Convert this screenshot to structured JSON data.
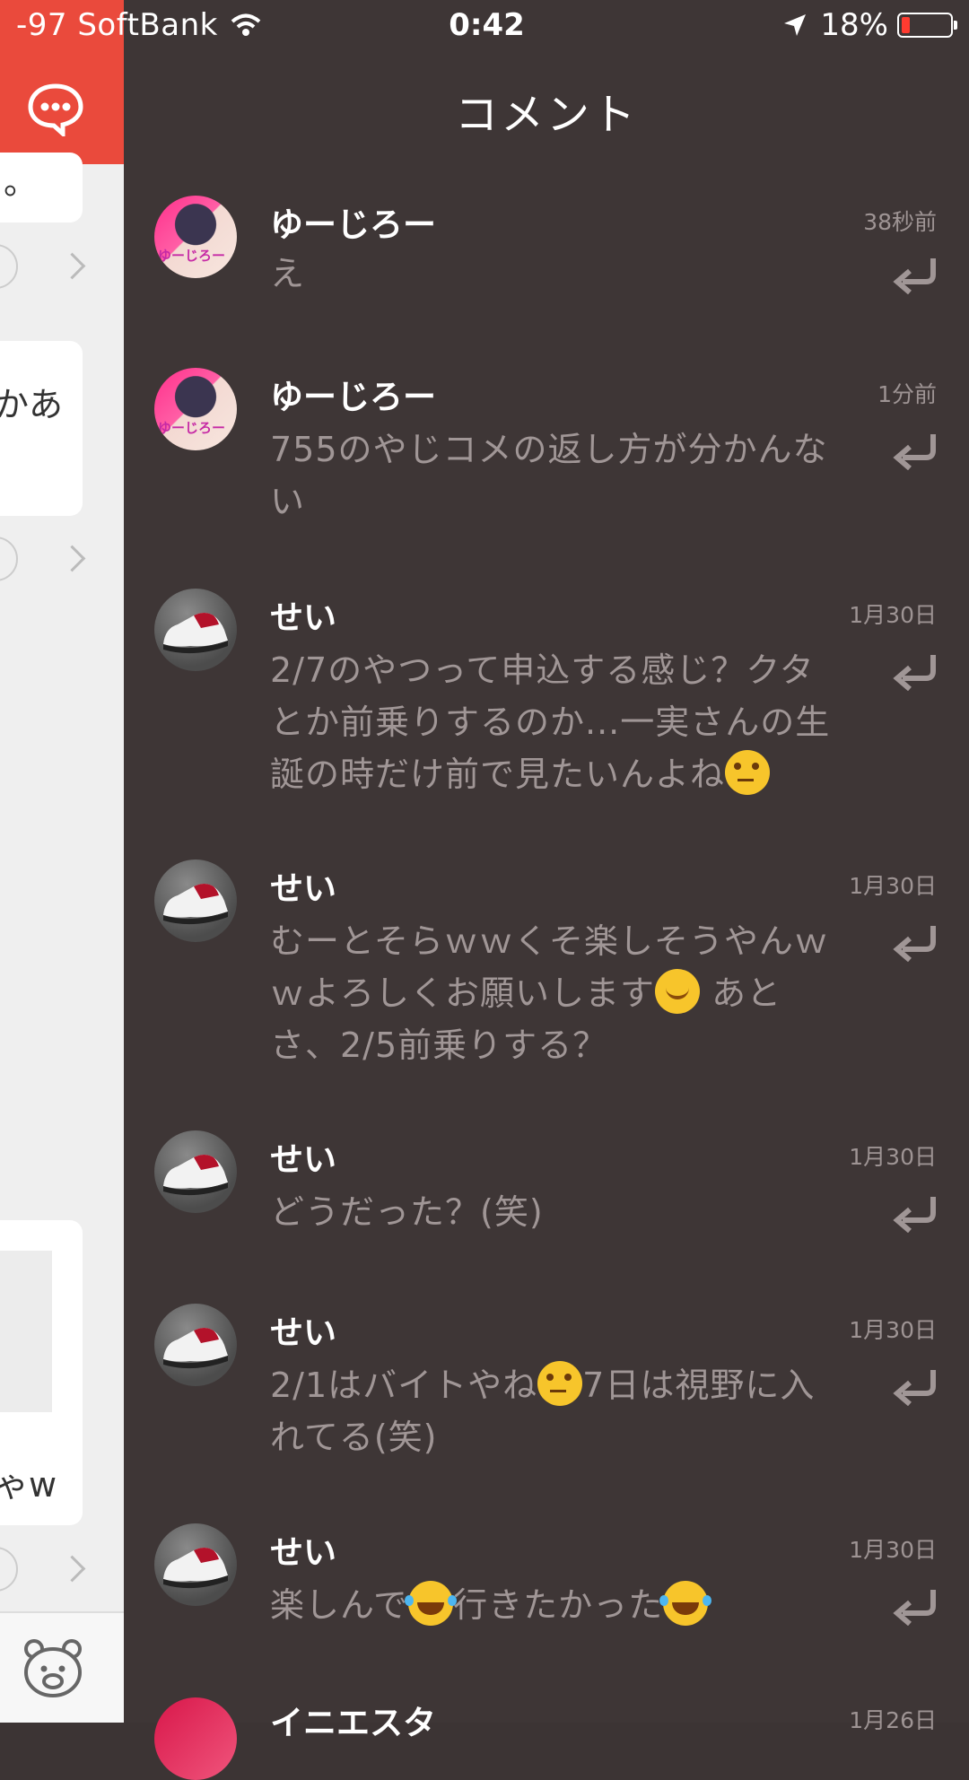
{
  "status_bar": {
    "carrier": "-97 SoftBank",
    "time": "0:42",
    "battery": "18%",
    "battery_level": 0.18
  },
  "background_feed": {
    "fragments": [
      "。",
      "かあ",
      "ゃw"
    ]
  },
  "comments_panel": {
    "title": "コメント",
    "comments": [
      {
        "name": "ゆーじろー",
        "time": "38秒前",
        "text": "え",
        "avatar_tag": "ゆーじろー"
      },
      {
        "name": "ゆーじろー",
        "time": "1分前",
        "text": "755のやじコメの返し方が分かんない",
        "avatar_tag": "ゆーじろー"
      },
      {
        "name": "せい",
        "time": "1月30日",
        "text_1": "2/7のやつって申込する感じ？クタとか前乗りするのか...一実さんの生誕の時だけ前で見たいんよね",
        "emoji": "thinking-face"
      },
      {
        "name": "せい",
        "time": "1月30日",
        "text_1": "むーとそらｗｗくそ楽しそうやんｗｗよろしくお願いします",
        "text_2": " あとさ、2/5前乗りする？",
        "emoji": "smiling-face"
      },
      {
        "name": "せい",
        "time": "1月30日",
        "text": "どうだった？(笑)"
      },
      {
        "name": "せい",
        "time": "1月30日",
        "text_1": "2/1はバイトやね",
        "text_2": "7日は視野に入れてる(笑)",
        "emoji": "thinking-face"
      },
      {
        "name": "せい",
        "time": "1月30日",
        "text_1": "楽しんで",
        "text_2": "行きたかった",
        "emoji": "tears-of-joy"
      },
      {
        "name": "イニエスタ",
        "time": "1月26日"
      }
    ]
  }
}
